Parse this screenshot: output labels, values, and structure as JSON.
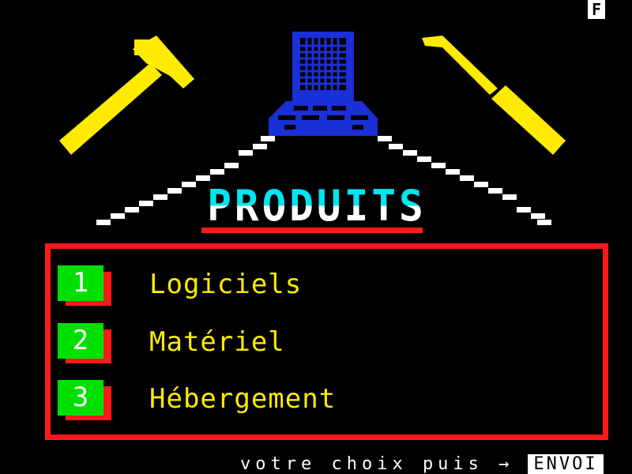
{
  "header": {
    "corner_letter": "F"
  },
  "page": {
    "title": "PRODUITS"
  },
  "menu": {
    "items": [
      {
        "number": "1",
        "label": "Logiciels"
      },
      {
        "number": "2",
        "label": "Matériel"
      },
      {
        "number": "3",
        "label": "Hébergement"
      }
    ]
  },
  "footer": {
    "prompt": "votre choix puis →",
    "button_label": "ENVOI"
  },
  "colors": {
    "background": "#000000",
    "title_cyan": "#00e6f0",
    "accent_red": "#ff1a1a",
    "label_yellow": "#ffeb00",
    "number_green": "#00e000",
    "computer_blue": "#1a2fd6",
    "tool_yellow": "#ffeb00"
  },
  "icons": [
    "hammer-icon",
    "computer-icon",
    "screwdriver-icon"
  ]
}
